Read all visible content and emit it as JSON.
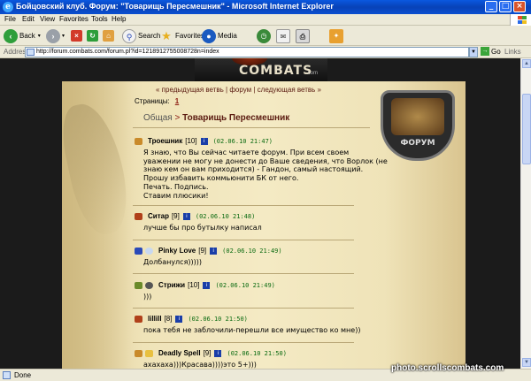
{
  "window": {
    "title": "Бойцовский клуб. Форум: \"Товарищь Пересмешник\" - Microsoft Internet Explorer",
    "minimize": "_",
    "maximize": "□",
    "close": "×"
  },
  "menu": [
    "File",
    "Edit",
    "View",
    "Favorites",
    "Tools",
    "Help"
  ],
  "toolbar": {
    "back_label": "Back",
    "search_label": "Search",
    "favorites_label": "Favorites",
    "media_label": "Media"
  },
  "address": {
    "label": "Address",
    "url": "http://forum.combats.com/forum.pl?id=1218912755008728n=index",
    "go_label": "Go",
    "links_label": "Links"
  },
  "site": {
    "logo": "COMBATS",
    "logo_suffix": ".com",
    "shield_label": "ФОРУМ"
  },
  "forum": {
    "nav": "« предыдущая ветвь | форум | следующая ветвь »",
    "pages_label": "Страницы:",
    "current_page": "1",
    "crumb_root": "Общая",
    "crumb_sep": " > ",
    "topic_title": "Товарищь Пересмешник",
    "posts": [
      {
        "author": "Троешник",
        "level": "[10]",
        "date": "(02.06.10 21:47)",
        "icon_color": "#c98a2a",
        "body": "Я знаю, что Вы сейчас читаете форум. При всем своем\nуважении не могу не донести до Ваше сведения, что Ворлок (не\nзнаю кем он вам приходится) - Гандон, самый настоящий.\nПрошу избавить коммьюнити БК от него.\nПечать. Подпись.\nСтавим плюсики!"
      },
      {
        "author": "Ситар",
        "level": "[9]",
        "date": "(02.06.10 21:48)",
        "icon_color": "#b0401a",
        "body": "лучше бы про бутылку написал"
      },
      {
        "author": "Pinky Love",
        "level": "[9]",
        "date": "(02.06.10 21:49)",
        "icon_color": "#2a4ab8",
        "body": "Долбанулся)))))"
      },
      {
        "author": "Стрижи",
        "level": "[10]",
        "date": "(02.06.10 21:49)",
        "icon_color": "#6a8a2a",
        "body": ")))"
      },
      {
        "author": "lillill",
        "level": "[8]",
        "date": "(02.06.10 21:50)",
        "icon_color": "#b0401a",
        "body": "пока тебя не заблочили-перешли все имущество ко мне))"
      },
      {
        "author": "Deadly Spell",
        "level": "[9]",
        "date": "(02.06.10 21:50)",
        "icon_color": "#c98a2a",
        "body": "ахахаха)))Красава))))это 5+)))"
      }
    ]
  },
  "status": {
    "text": "Done",
    "watermark": "photo.scrollscombats.com"
  }
}
